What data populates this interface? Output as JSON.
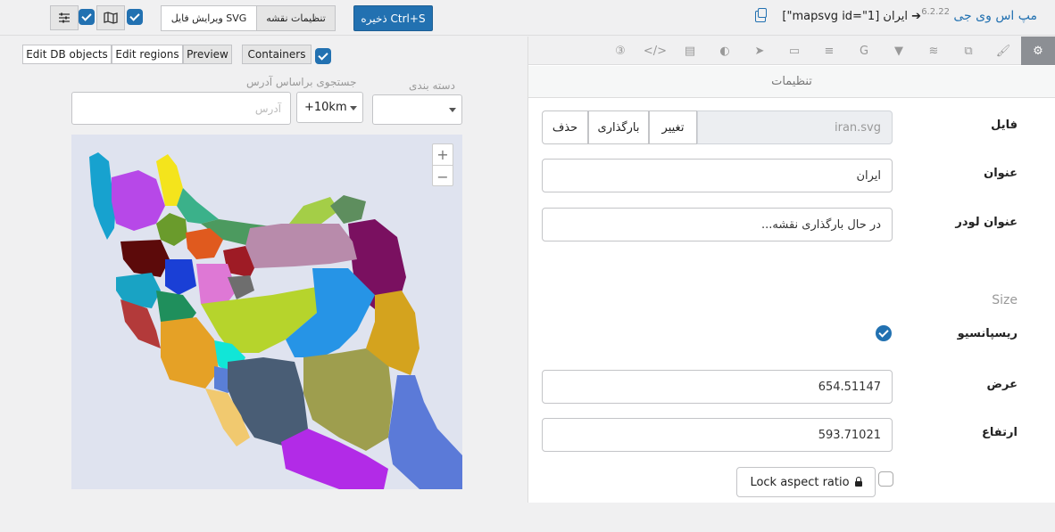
{
  "header": {
    "app_title": "مپ اس وی جی",
    "version": "6.2.22",
    "breadcrumb": "[\"mapsvg id=\"1] ایران ➔",
    "save_label": "ذخیره Ctrl+S",
    "map_settings_label": "تنظیمات نقشه",
    "edit_svg_label": "ویرایش فایل SVG"
  },
  "toolbar_left": {
    "containers_label": "Containers",
    "preview_label": "Preview",
    "edit_regions_label": "Edit regions",
    "edit_db_label": "Edit DB objects"
  },
  "filters": {
    "category_label": "دسته بندی",
    "search_label": "جستجوی براساس آدرس",
    "address_placeholder": "آدرس",
    "distance_value": "+10km",
    "category_value": ""
  },
  "map": {
    "zoom_in": "+",
    "zoom_out": "−"
  },
  "tabs": [
    {
      "icon": "gear-icon",
      "glyph": "⚙",
      "active": true
    },
    {
      "icon": "brush-icon",
      "glyph": "🖌"
    },
    {
      "icon": "layers-icon",
      "glyph": "⧉"
    },
    {
      "icon": "database-icon",
      "glyph": "≋"
    },
    {
      "icon": "filter-icon",
      "glyph": "▼"
    },
    {
      "icon": "google-icon",
      "glyph": "G"
    },
    {
      "icon": "list-icon",
      "glyph": "≡"
    },
    {
      "icon": "id-card-icon",
      "glyph": "▭"
    },
    {
      "icon": "pointer-icon",
      "glyph": "➤"
    },
    {
      "icon": "toggle-icon",
      "glyph": "◐"
    },
    {
      "icon": "file-icon",
      "glyph": "▤"
    },
    {
      "icon": "code-icon",
      "glyph": "</>"
    },
    {
      "icon": "css-icon",
      "glyph": "③"
    }
  ],
  "settings": {
    "section_title": "تنظیمات",
    "file_label": "فایل",
    "file_value": "iran.svg",
    "change_label": "تغییر",
    "reload_label": "بارگذاری",
    "delete_label": "حذف",
    "title_label": "عنوان",
    "title_value": "ایران",
    "loader_label": "عنوان لودر",
    "loader_value": "در حال بارگذاری نقشه...",
    "size_label": "Size",
    "responsive_label": "ریسپانسیو",
    "width_label": "عرض",
    "width_value": "654.51147",
    "height_label": "ارتفاع",
    "height_value": "593.71021",
    "lock_label": "Lock aspect ratio"
  },
  "colors": {
    "accent": "#2271b1",
    "map_bg": "#dfe3ef"
  }
}
